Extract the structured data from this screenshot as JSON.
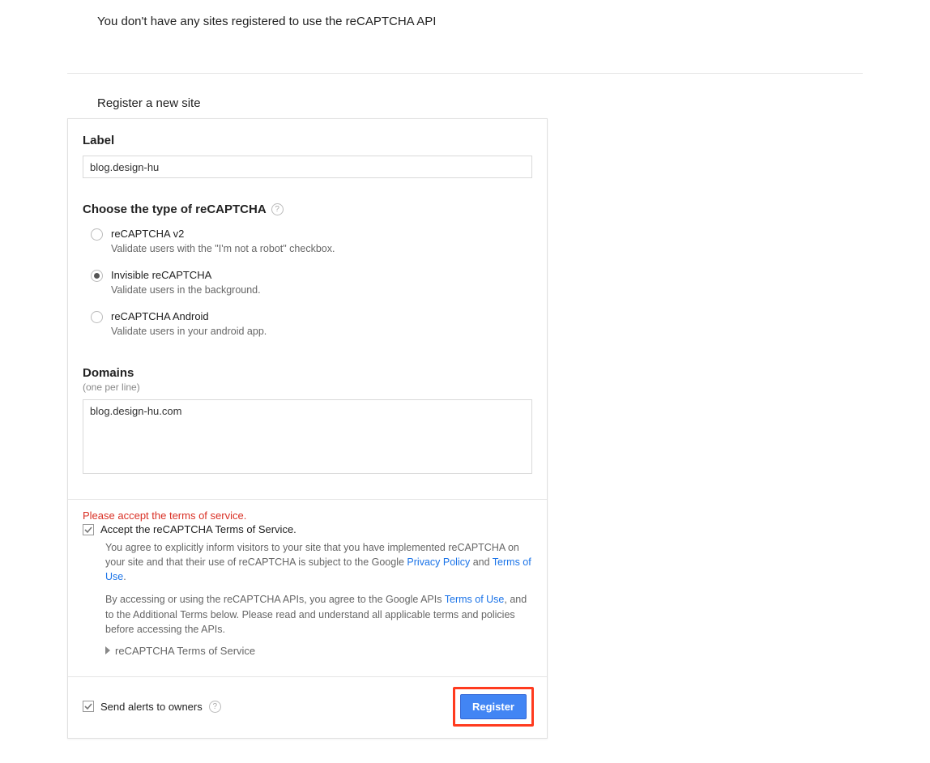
{
  "top_message": "You don't have any sites registered to use the reCAPTCHA API",
  "section_title": "Register a new site",
  "form": {
    "label_heading": "Label",
    "label_value": "blog.design-hu",
    "choose_heading": "Choose the type of reCAPTCHA",
    "options": [
      {
        "title": "reCAPTCHA v2",
        "desc": "Validate users with the \"I'm not a robot\" checkbox.",
        "selected": false
      },
      {
        "title": "Invisible reCAPTCHA",
        "desc": "Validate users in the background.",
        "selected": true
      },
      {
        "title": "reCAPTCHA Android",
        "desc": "Validate users in your android app.",
        "selected": false
      }
    ],
    "domains_heading": "Domains",
    "domains_sub": "(one per line)",
    "domains_value": "blog.design-hu.com"
  },
  "tos": {
    "error": "Please accept the terms of service.",
    "accept_label": "Accept the reCAPTCHA Terms of Service.",
    "p1_a": "You agree to explicitly inform visitors to your site that you have implemented reCAPTCHA on your site and that their use of reCAPTCHA is subject to the Google ",
    "privacy": "Privacy Policy",
    "p1_b": " and ",
    "tou1": "Terms of Use",
    "p1_c": ".",
    "p2_a": "By accessing or using the reCAPTCHA APIs, you agree to the Google APIs ",
    "tou2": "Terms of Use",
    "p2_b": ", and to the Additional Terms below. Please read and understand all applicable terms and policies before accessing the APIs.",
    "expand_label": "reCAPTCHA Terms of Service"
  },
  "footer": {
    "alerts_label": "Send alerts to owners",
    "register_label": "Register"
  }
}
